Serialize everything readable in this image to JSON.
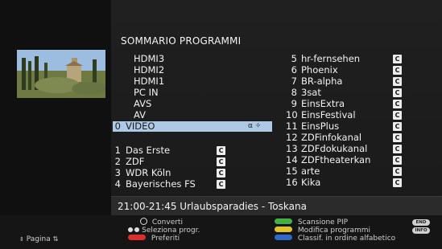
{
  "title": "SOMMARIO PROGRAMMI",
  "sources": [
    {
      "label": "HDMI3"
    },
    {
      "label": "HDMI2"
    },
    {
      "label": "HDMI1"
    },
    {
      "label": "PC IN"
    },
    {
      "label": "AVS"
    },
    {
      "label": "AV"
    }
  ],
  "selected_source": {
    "number": "0",
    "label": "VIDEO",
    "icons": "α ✧"
  },
  "left_channels": [
    {
      "number": "1",
      "name": "Das Erste",
      "badge": "C"
    },
    {
      "number": "2",
      "name": "ZDF",
      "badge": "C"
    },
    {
      "number": "3",
      "name": "WDR Köln",
      "badge": "C"
    },
    {
      "number": "4",
      "name": "Bayerisches FS",
      "badge": "C"
    }
  ],
  "right_channels": [
    {
      "number": "5",
      "name": "hr-fernsehen",
      "badge": "C"
    },
    {
      "number": "6",
      "name": "Phoenix",
      "badge": "C"
    },
    {
      "number": "7",
      "name": "BR-alpha",
      "badge": "C"
    },
    {
      "number": "8",
      "name": "3sat",
      "badge": "C"
    },
    {
      "number": "9",
      "name": "EinsExtra",
      "badge": "C"
    },
    {
      "number": "10",
      "name": "EinsFestival",
      "badge": "C"
    },
    {
      "number": "11",
      "name": "EinsPlus",
      "badge": "C"
    },
    {
      "number": "12",
      "name": "ZDFinfokanal",
      "badge": "C"
    },
    {
      "number": "13",
      "name": "ZDFdokukanal",
      "badge": "C"
    },
    {
      "number": "14",
      "name": "ZDFtheaterkan",
      "badge": "C"
    },
    {
      "number": "15",
      "name": "arte",
      "badge": "C"
    },
    {
      "number": "16",
      "name": "Kika",
      "badge": "C"
    }
  ],
  "now_playing": "21:00-21:45 Urlaubsparadies - Toskana",
  "footer": {
    "page_label": "Pagina",
    "convert_label": "Converti",
    "select_label": "Seleziona progr.",
    "favorites_label": "Preferiti",
    "pip_label": "Scansione PIP",
    "modify_label": "Modifica programmi",
    "sort_label": "Classif. in ordine alfabetico",
    "end_key": "END",
    "info_key": "INFO"
  },
  "colors": {
    "selection": "#aec9e6",
    "red": "#d9302e",
    "green": "#43b043",
    "yellow": "#e0c42a",
    "blue": "#2f68c8"
  }
}
